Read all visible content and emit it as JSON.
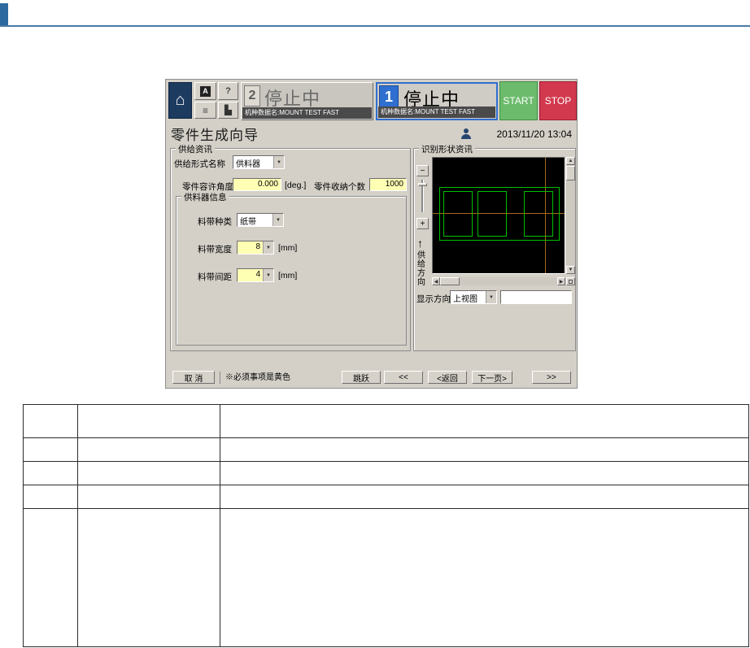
{
  "icons": {
    "home": "⌂",
    "letter_a": "A",
    "help": "?",
    "menu": "≡",
    "tool": "▙",
    "minus": "−",
    "plus": "+",
    "up_arrow": "↑",
    "scroll_up": "▲",
    "scroll_down": "▼",
    "scroll_left": "◀",
    "scroll_right": "▶",
    "dropdown": "▼"
  },
  "machine_ui": {
    "toolbar": {
      "status_panels": [
        {
          "number": "2",
          "state": "停止中",
          "machine_name": "机种数据名:MOUNT TEST FAST"
        },
        {
          "number": "1",
          "state": "停止中",
          "machine_name": "机种数据名:MOUNT TEST FAST"
        }
      ],
      "start_label": "START",
      "stop_label": "STOP"
    },
    "title_bar": {
      "title": "零件生成向导",
      "datetime": "2013/11/20 13:04"
    },
    "supply_info": {
      "legend": "供给资讯",
      "form_label": "供给形式名称",
      "form_value": "供料器",
      "angle_label": "零件容许角度",
      "angle_value": "0.000",
      "angle_unit": "[deg.]",
      "count_label": "零件收纳个数",
      "count_value": "1000",
      "feeder": {
        "legend": "供料器信息",
        "tape_type_label": "料带种类",
        "tape_type_value": "纸带",
        "tape_width_label": "料带宽度",
        "tape_width_value": "8",
        "tape_width_unit": "[mm]",
        "tape_pitch_label": "料带间距",
        "tape_pitch_value": "4",
        "tape_pitch_unit": "[mm]"
      }
    },
    "recognition": {
      "legend": "识别形状资讯",
      "feed_direction_label": "供给方向",
      "display_label": "显示方向",
      "display_value": "上视图",
      "box_value": ""
    },
    "footer": {
      "cancel_label": "取 消",
      "note": "※必须事项是黄色",
      "jump_label": "跳跃",
      "rewind_label": "<<",
      "back_label": "<返回",
      "next_label": "下一页>",
      "forward_label": ">>"
    }
  },
  "table": {
    "rows": [
      [
        "",
        "",
        ""
      ],
      [
        "",
        "",
        ""
      ],
      [
        "",
        "",
        ""
      ],
      [
        "",
        "",
        ""
      ],
      [
        "",
        "",
        ""
      ]
    ]
  },
  "colors": {
    "accent_blue": "#2f6fd0",
    "start_green": "#6cbb6c",
    "stop_red": "#d2394e",
    "required_yellow": "#ffffb4",
    "view_green": "#00c000",
    "crosshair_orange": "#a5691c"
  }
}
